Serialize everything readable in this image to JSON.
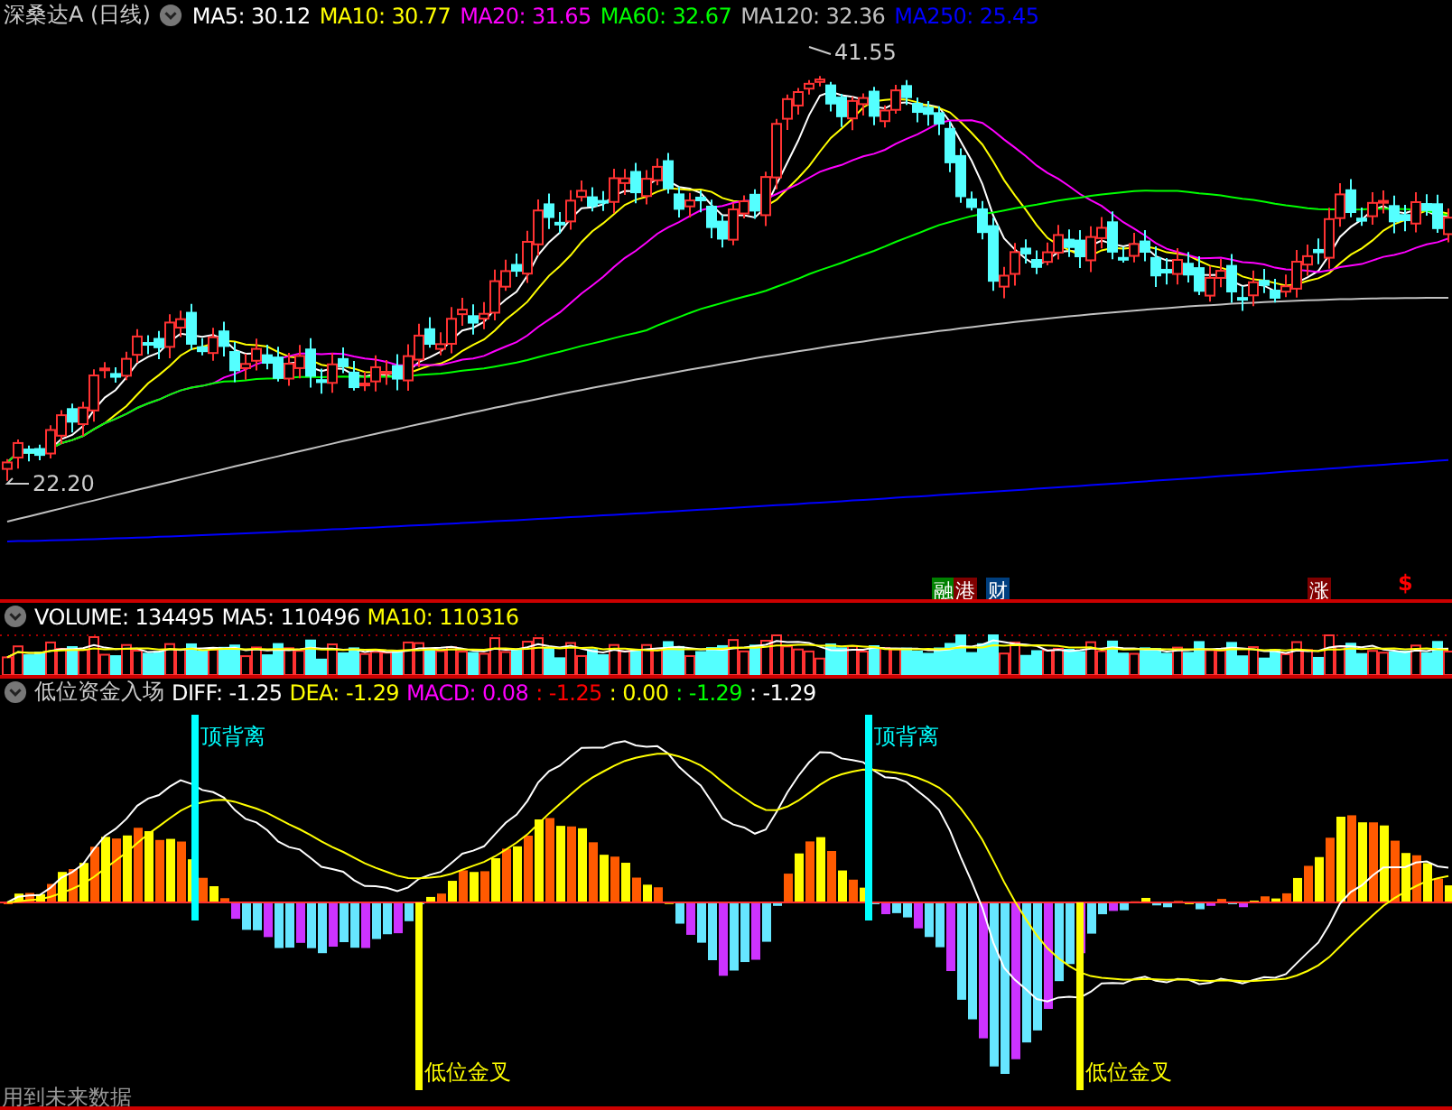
{
  "price_panel": {
    "title": "深桑达A (日线)",
    "legend": [
      {
        "text": "MA5: 30.12",
        "color": "#ffffff"
      },
      {
        "text": "MA10: 30.77",
        "color": "#ffff00"
      },
      {
        "text": "MA20: 31.65",
        "color": "#ff00ff"
      },
      {
        "text": "MA60: 32.67",
        "color": "#00ff00"
      },
      {
        "text": "MA120: 32.36",
        "color": "#c0c0c0"
      },
      {
        "text": "MA250: 25.45",
        "color": "#0000ff"
      }
    ],
    "high_label": "41.55",
    "low_label": "22.20",
    "events": [
      {
        "kind": "tag",
        "text": "融",
        "color": "#008000"
      },
      {
        "kind": "tag",
        "text": "港",
        "color": "#800000"
      },
      {
        "kind": "tag",
        "text": "财",
        "color": "#003f7f"
      },
      {
        "kind": "tag",
        "text": "涨",
        "color": "#800000"
      },
      {
        "kind": "symbol",
        "text": "$",
        "color": "#ff0000"
      }
    ]
  },
  "volume_panel": {
    "legend": [
      {
        "text": "VOLUME: 134495",
        "color": "#ffffff"
      },
      {
        "text": "MA5: 110496",
        "color": "#ffffff"
      },
      {
        "text": "MA10: 110316",
        "color": "#ffff00"
      }
    ]
  },
  "indicator_panel": {
    "title": "低位资金入场",
    "legend": [
      {
        "text": "DIFF: -1.25",
        "color": "#ffffff"
      },
      {
        "text": "DEA: -1.29",
        "color": "#ffff00"
      },
      {
        "text": "MACD: 0.08",
        "color": "#ff00ff"
      },
      {
        "text": ": -1.25",
        "color": "#ff0000"
      },
      {
        "text": ": 0.00",
        "color": "#ffff00"
      },
      {
        "text": ": -1.29",
        "color": "#00ff00"
      },
      {
        "text": ": -1.29",
        "color": "#ffffff"
      }
    ],
    "signals": [
      {
        "kind": "top-divergence",
        "label": "顶背离"
      },
      {
        "kind": "low-golden-cross",
        "label": "低位金叉"
      },
      {
        "kind": "top-divergence",
        "label": "顶背离"
      },
      {
        "kind": "low-golden-cross",
        "label": "低位金叉"
      }
    ],
    "footer_note": "用到未来数据"
  }
}
